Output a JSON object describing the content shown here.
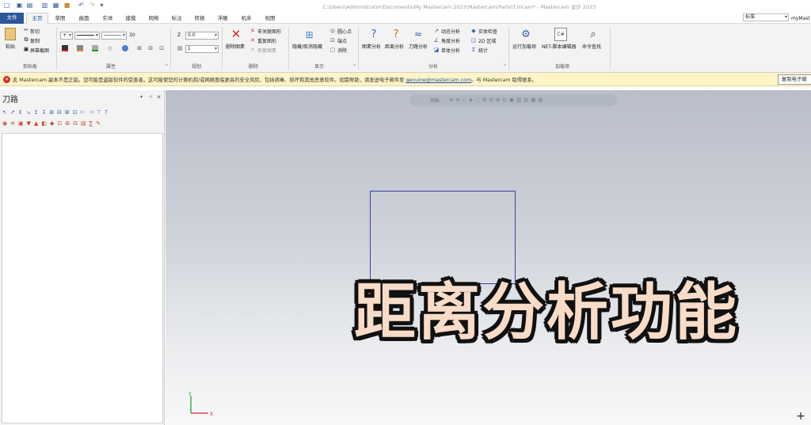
{
  "window": {
    "title": "C:\\Users\\Administrator\\Documents\\My Mastercam 2023\\Mastercam\\Parts\\T.mcam* - Mastercam 设计 2023"
  },
  "tabs": [
    "文件",
    "主页",
    "草图",
    "曲面",
    "实体",
    "建模",
    "网格",
    "标注",
    "转换",
    "浮雕",
    "机床",
    "视图"
  ],
  "right_controls": {
    "layout_combo": "标准",
    "user": "myMast"
  },
  "ribbon": {
    "clipboard": {
      "paste": "粘贴",
      "cut": "剪切",
      "copy": "复制",
      "screenshot": "屏幕截图",
      "group": "剪贴板"
    },
    "attributes": {
      "line_width_value": "30",
      "group": "属性"
    },
    "planes": {
      "z_label": "Z",
      "z_value": "0.0",
      "level_value": "1",
      "group": "规划"
    },
    "delete": {
      "delete_entity": "删除图素",
      "non_associative": "非关联图形",
      "duplicate": "重复图形",
      "restore": "恢复图素",
      "group": "删除"
    },
    "display": {
      "hide_show": "隐藏/取消隐藏",
      "center_point": "圆心点",
      "endpoints": "端点",
      "clear": "消除",
      "group": "显示"
    },
    "analysis": {
      "entity_analysis": "图素分析",
      "distance_analysis": "距离分析",
      "toolpath_analysis": "刀路分析",
      "dynamic": "动态分析",
      "angle": "角度分析",
      "single_body": "单体分析",
      "solid_check": "实体检查",
      "zone_2d": "2D 区域",
      "statistics": "统计",
      "group": "分析"
    },
    "addins": {
      "run_addin": "运行加载项",
      "net_editor": "NET-脚本编辑器",
      "command_finder": "命令查找",
      "group": "加载项"
    }
  },
  "warning": {
    "text_before": "此 Mastercam 副本不是正版。您可能是盗版软件的受害者。这可能使您的计算机和/或网络面临更高的安全风险、包括病毒、损坏和其他恶意软件。如需帮助，请发送电子邮件至",
    "email": "genuine@mastercam.com",
    "text_after": "。与 Mastercam 取得联系。",
    "button": "复制电子邮"
  },
  "left_panel": {
    "title": "刀路"
  },
  "viewport": {
    "toolbar_label": "光标",
    "overlay_text": "距离分析功能"
  },
  "colors": {
    "file_tab": "#2b579a",
    "warn_bg": "#fff4c6",
    "shape_stroke": "#3c3caa",
    "overlay_fill": "#f8dcc7"
  }
}
